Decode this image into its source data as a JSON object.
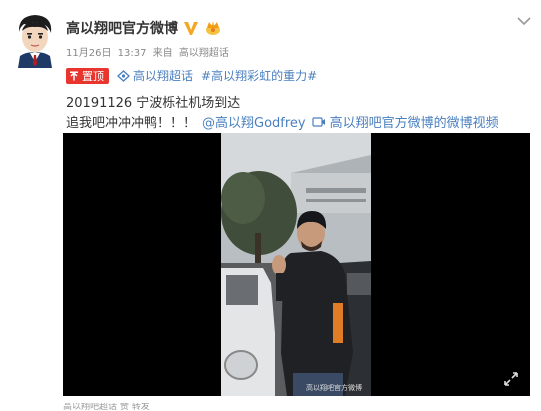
{
  "post": {
    "author_name": "高以翔吧官方微博",
    "date": "11月26日",
    "time": "13:37",
    "source_prefix": "来自",
    "source_name": "高以翔超话",
    "pinned_label": "置顶",
    "topic_link": "高以翔超话",
    "hashtag": "#高以翔彩虹的重力#",
    "text_line1": "20191126 宁波栎社机场到达",
    "text_line2": "追我吧冲冲冲鸭！！！",
    "mention": "@高以翔Godfrey",
    "video_link": "高以翔吧官方微博的微博视频",
    "video_watermark": "高以翔吧官方微博",
    "bottom_text": "高以翔吧超话 赞 转发"
  },
  "icons": {
    "verify": "verified-v-icon",
    "gold": "gold-crown-icon",
    "chevron": "chevron-down-icon",
    "pin": "pin-icon",
    "topic": "super-topic-icon",
    "video": "video-camera-icon",
    "fullscreen": "fullscreen-icon"
  },
  "colors": {
    "link": "#4a7fbf",
    "pinned": "#e8362f",
    "verify": "#f5a623"
  }
}
